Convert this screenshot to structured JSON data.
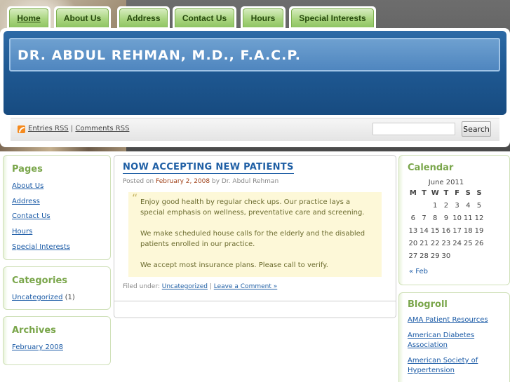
{
  "nav": {
    "tabs": [
      {
        "label": "Home"
      },
      {
        "label": "About Us"
      },
      {
        "label": "Address"
      },
      {
        "label": "Contact Us"
      },
      {
        "label": "Hours"
      },
      {
        "label": "Special Interests"
      }
    ]
  },
  "header": {
    "title": "DR. ABDUL REHMAN, M.D., F.A.C.P.",
    "entries_rss": "Entries RSS",
    "separator": "|",
    "comments_rss": "Comments RSS",
    "search_placeholder": "",
    "search_button": "Search"
  },
  "sidebar_left": {
    "pages": {
      "title": "Pages",
      "items": [
        "About Us",
        "Address",
        "Contact Us",
        "Hours",
        "Special Interests"
      ]
    },
    "categories": {
      "title": "Categories",
      "item": "Uncategorized",
      "count": "(1)"
    },
    "archives": {
      "title": "Archives",
      "item": "February 2008"
    }
  },
  "post": {
    "title": "NOW ACCEPTING NEW PATIENTS",
    "posted_on": "Posted on",
    "date": "February 2, 2008",
    "by": "by Dr. Abdul Rehman",
    "quote_mark": "“",
    "paragraphs": [
      "Enjoy good health by regular check ups. Our practice lays a special emphasis on wellness, preventative care and screening.",
      "We make scheduled house calls for the elderly and the disabled patients enrolled in our practice.",
      "We accept most insurance plans. Please call to verify."
    ],
    "filed_under": "Filed under:",
    "category": "Uncategorized",
    "sep": "|",
    "comment_link": "Leave a Comment »"
  },
  "sidebar_right": {
    "calendar": {
      "title": "Calendar",
      "caption": "June 2011",
      "weekdays": [
        "M",
        "T",
        "W",
        "T",
        "F",
        "S",
        "S"
      ],
      "weeks": [
        [
          "",
          "",
          "1",
          "2",
          "3",
          "4",
          "5"
        ],
        [
          "6",
          "7",
          "8",
          "9",
          "10",
          "11",
          "12"
        ],
        [
          "13",
          "14",
          "15",
          "16",
          "17",
          "18",
          "19"
        ],
        [
          "20",
          "21",
          "22",
          "23",
          "24",
          "25",
          "26"
        ],
        [
          "27",
          "28",
          "29",
          "30",
          "",
          "",
          ""
        ]
      ],
      "prev": "« Feb"
    },
    "blogroll": {
      "title": "Blogroll",
      "items": [
        "AMA Patient Resources",
        "American Diabetes Association",
        "American Society of Hypertension"
      ]
    }
  },
  "colors": {
    "accent_green": "#7aa64b",
    "header_blue": "#1f5993",
    "link_blue": "#1a5aa6"
  }
}
